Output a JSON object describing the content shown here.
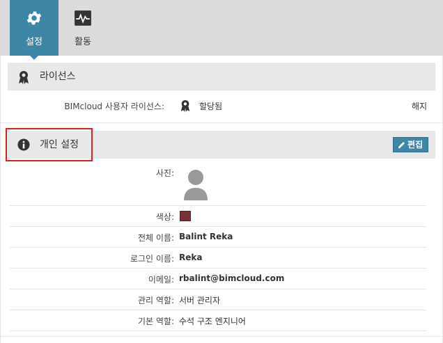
{
  "tabs": [
    {
      "label": "설정",
      "icon": "gear-icon",
      "active": true
    },
    {
      "label": "활동",
      "icon": "activity-monitor-icon",
      "active": false
    }
  ],
  "license_section": {
    "title": "라이선스",
    "icon": "award-ribbon-icon",
    "row_label": "BIMcloud 사용자 라이선스:",
    "status_icon": "award-ribbon-icon",
    "status": "할당됨",
    "revoke_link": "해지"
  },
  "personal_section": {
    "title": "개인 설정",
    "icon": "info-icon",
    "edit_button": "편집",
    "fields": {
      "photo_label": "사진:",
      "color_label": "색상:",
      "color_value": "#7a2f36",
      "full_name_label": "전체 이름:",
      "full_name": "Balint Reka",
      "login_name_label": "로그인 이름:",
      "login_name": "Reka",
      "email_label": "이메일:",
      "email": "rbalint@bimcloud.com",
      "admin_role_label": "관리 역할:",
      "admin_role": "서버 관리자",
      "default_role_label": "기본 역할:",
      "default_role": "수석 구조 엔지니어"
    }
  },
  "colors": {
    "accent": "#3d86a5",
    "topbar": "#dcdcdc",
    "section_header": "#e8e8e8",
    "highlight": "#e02020"
  }
}
